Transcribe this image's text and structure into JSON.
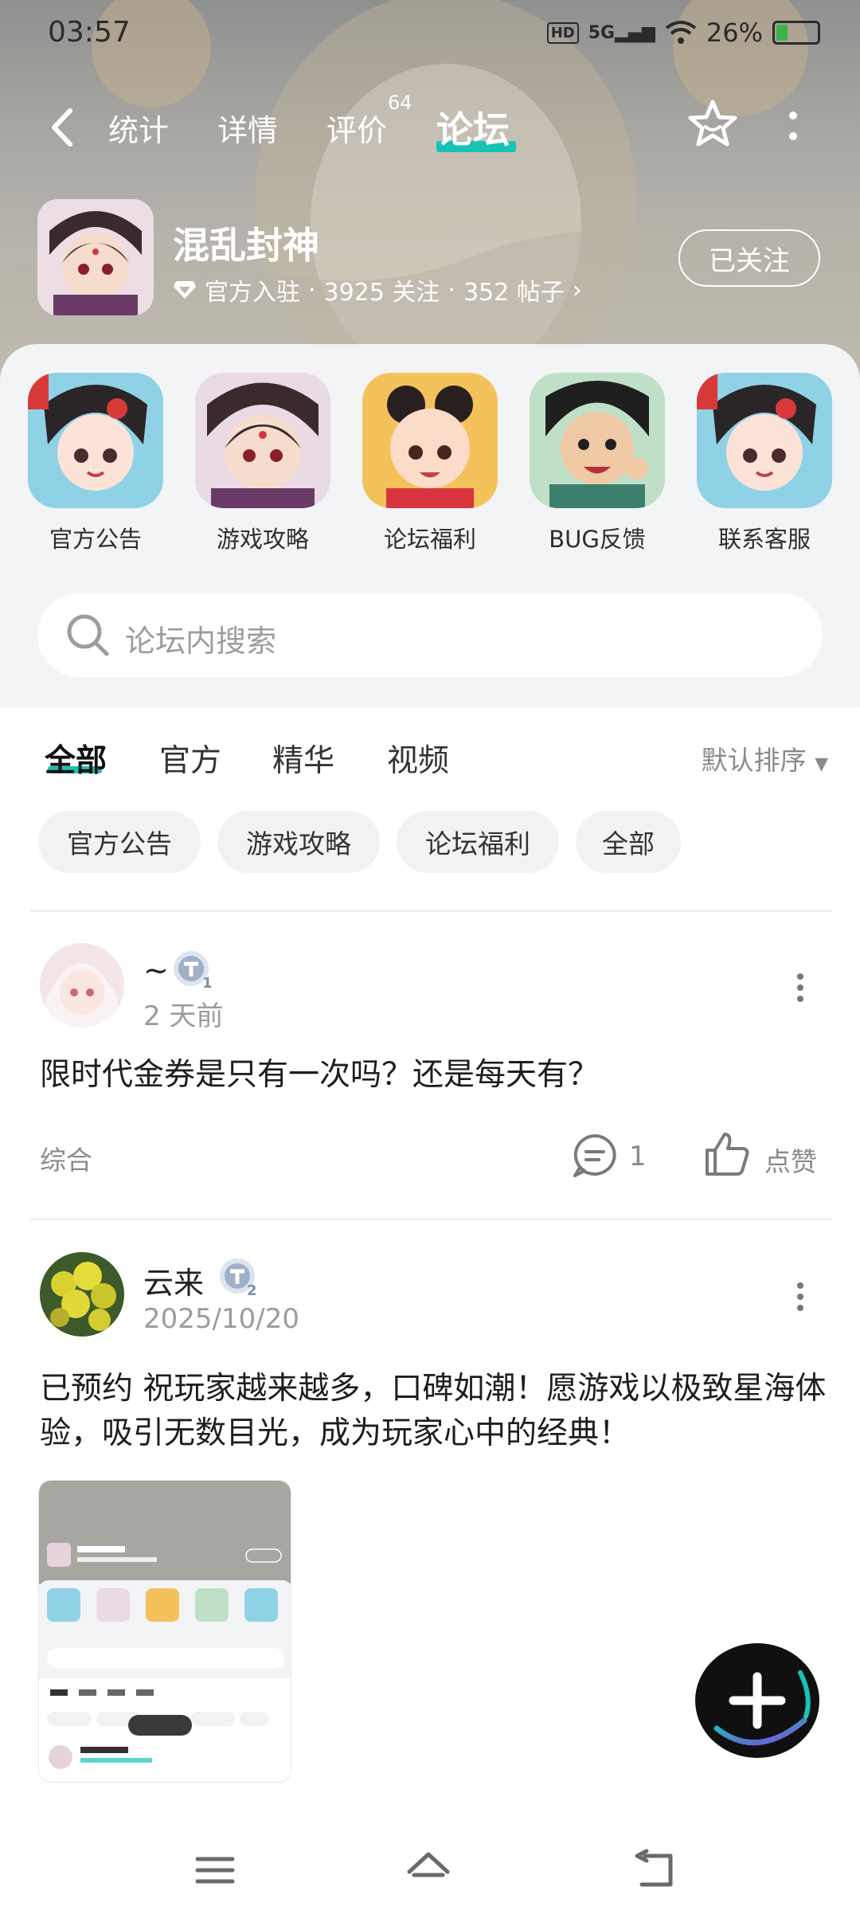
{
  "status_bar": {
    "time": "03:57",
    "network": "5G",
    "hd": "HD",
    "battery": "26%"
  },
  "nav": {
    "tabs": [
      {
        "label": "统计"
      },
      {
        "label": "详情"
      },
      {
        "label": "评价",
        "badge": "64"
      },
      {
        "label": "论坛"
      }
    ],
    "active_tab": "论坛"
  },
  "game": {
    "name": "混乱封神",
    "official": "官方入驻",
    "followers": "3925 关注",
    "posts": "352 帖子",
    "follow_button": "已关注"
  },
  "categories": [
    {
      "label": "官方公告"
    },
    {
      "label": "游戏攻略"
    },
    {
      "label": "论坛福利"
    },
    {
      "label": "BUG反馈"
    },
    {
      "label": "联系客服"
    }
  ],
  "search": {
    "placeholder": "论坛内搜索"
  },
  "filter_tabs": [
    {
      "label": "全部"
    },
    {
      "label": "官方"
    },
    {
      "label": "精华"
    },
    {
      "label": "视频"
    }
  ],
  "sort": {
    "label": "默认排序"
  },
  "chips": [
    {
      "label": "官方公告"
    },
    {
      "label": "游戏攻略"
    },
    {
      "label": "论坛福利"
    },
    {
      "label": "全部"
    }
  ],
  "posts": [
    {
      "author": "~",
      "level": "1",
      "time": "2 天前",
      "text": "限时代金券是只有一次吗？还是每天有？",
      "tag": "综合",
      "comments": "1",
      "like_label": "点赞"
    },
    {
      "author": "云来",
      "level": "2",
      "time": "2025/10/20",
      "text": "已预约 祝玩家越来越多，口碑如潮！愿游戏以极致星海体验，吸引无数目光，成为玩家心中的经典！"
    }
  ],
  "colors": {
    "accent": "#18c3b6",
    "sheet_bg": "#f3f4f6",
    "chip_bg": "#f1f2f4"
  }
}
